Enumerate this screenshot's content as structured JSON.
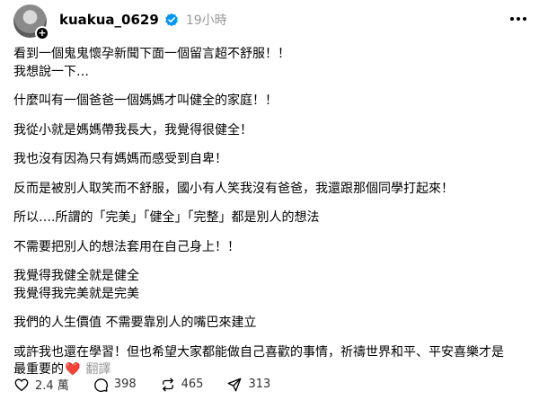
{
  "post": {
    "username": "kuakua_0629",
    "time": "19小時",
    "lines": [
      "看到一個鬼鬼懷孕新聞下面一個留言超不舒服！！",
      "我想說一下…",
      "什麼叫有一個爸爸一個媽媽才叫健全的家庭！！",
      "我從小就是媽媽帶我長大，我覺得很健全！",
      "我也沒有因為只有媽媽而感受到自卑！",
      "反而是被別人取笑而不舒服，國小有人笑我沒有爸爸，我還跟那個同學打起來！",
      "所以….所謂的「完美」「健全」「完整」都是別人的想法",
      "不需要把別人的想法套用在自己身上！！",
      "我覺得我健全就是健全",
      "我覺得我完美就是完美",
      "我們的人生價值 不需要靠別人的嘴巴來建立",
      "或許我也還在學習！但也希望大家都能做自己喜歡的事情，祈禱世界和平、平安喜樂才是",
      "最重要的"
    ],
    "heart_emoji": "❤️",
    "translate_label": "翻譯"
  },
  "actions": {
    "likes": "2.4 萬",
    "comments": "398",
    "reposts": "465",
    "shares": "313"
  },
  "icons": {
    "avatar_badge": "plus-icon",
    "verified": "verified-badge-icon",
    "more": "more-options-icon",
    "like": "heart-outline-icon",
    "comment": "comment-icon",
    "repost": "repost-icon",
    "share": "send-icon"
  },
  "colors": {
    "verified": "#0095f6",
    "heart": "#e0245e",
    "muted": "#999999"
  }
}
